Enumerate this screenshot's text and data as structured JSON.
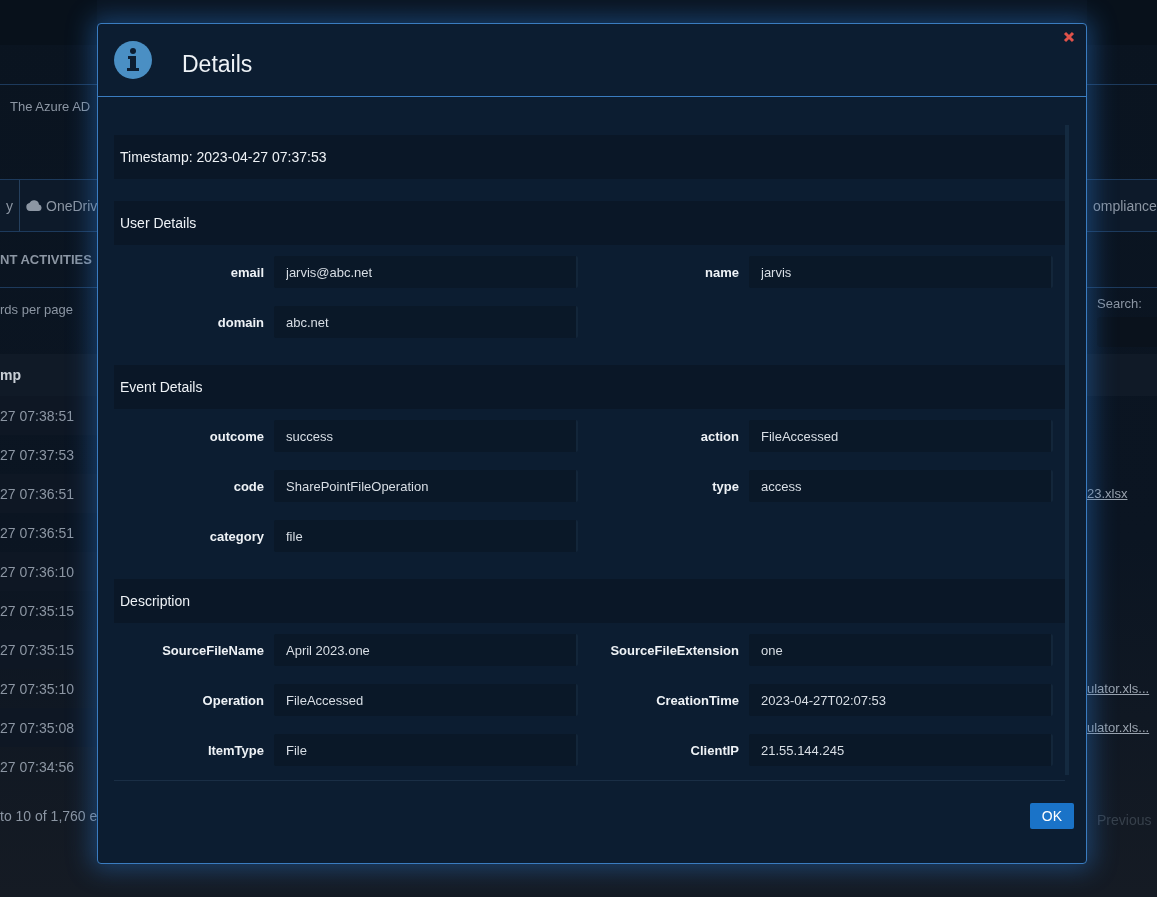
{
  "background": {
    "notice": "The Azure AD",
    "tabs": [
      {
        "label": "y",
        "kind": "plain"
      },
      {
        "label": "OneDriv",
        "kind": "cloud"
      }
    ],
    "tab_right": "ompliance",
    "heading": "NT ACTIVITIES",
    "page_size_label": "rds per page",
    "search_label": "Search:",
    "column_header": "mp",
    "rows": [
      {
        "time": "27 07:38:51"
      },
      {
        "time": "27 07:37:53"
      },
      {
        "time": "27 07:36:51",
        "link": "23.xlsx"
      },
      {
        "time": "27 07:36:51"
      },
      {
        "time": "27 07:36:10"
      },
      {
        "time": "27 07:35:15"
      },
      {
        "time": "27 07:35:15"
      },
      {
        "time": "27 07:35:10",
        "link": "ulator.xls..."
      },
      {
        "time": "27 07:35:08",
        "link": "ulator.xls..."
      },
      {
        "time": "27 07:34:56"
      }
    ],
    "footer_info": "to 10 of 1,760 e",
    "pager": {
      "label": "Previous",
      "disabled": true
    }
  },
  "modal": {
    "title": "Details",
    "timestamp": "Timestamp: 2023-04-27 07:37:53",
    "sections": [
      {
        "title": "User Details",
        "fields": [
          {
            "label": "email",
            "value": "jarvis@abc.net"
          },
          {
            "label": "name",
            "value": "jarvis"
          },
          {
            "label": "domain",
            "value": "abc.net"
          }
        ]
      },
      {
        "title": "Event Details",
        "fields": [
          {
            "label": "outcome",
            "value": "success"
          },
          {
            "label": "action",
            "value": "FileAccessed"
          },
          {
            "label": "code",
            "value": "SharePointFileOperation"
          },
          {
            "label": "type",
            "value": "access"
          },
          {
            "label": "category",
            "value": "file"
          }
        ]
      },
      {
        "title": "Description",
        "fields": [
          {
            "label": "SourceFileName",
            "value": "April 2023.one"
          },
          {
            "label": "SourceFileExtension",
            "value": "one"
          },
          {
            "label": "Operation",
            "value": "FileAccessed"
          },
          {
            "label": "CreationTime",
            "value": "2023-04-27T02:07:53"
          },
          {
            "label": "ItemType",
            "value": "File"
          },
          {
            "label": "ClientIP",
            "value": "21.55.144.245"
          }
        ]
      }
    ],
    "ok_button": "OK"
  }
}
